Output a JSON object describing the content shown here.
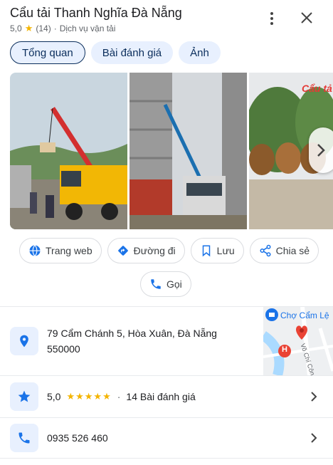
{
  "header": {
    "title": "Cẩu tải Thanh Nghĩa Đà Nẵng",
    "rating": "5,0",
    "review_count": "(14)",
    "category": "Dịch vụ vận tải"
  },
  "tabs": [
    {
      "label": "Tổng quan",
      "active": true
    },
    {
      "label": "Bài đánh giá",
      "active": false
    },
    {
      "label": "Ảnh",
      "active": false
    }
  ],
  "photos": {
    "overlay_text": "Cẩu tả"
  },
  "actions": [
    {
      "label": "Trang web",
      "icon": "globe-icon"
    },
    {
      "label": "Đường đi",
      "icon": "directions-icon"
    },
    {
      "label": "Lưu",
      "icon": "bookmark-icon"
    },
    {
      "label": "Chia sẻ",
      "icon": "share-icon"
    },
    {
      "label": "Gọi",
      "icon": "phone-icon"
    }
  ],
  "address": {
    "line1": "79 Cẩm Chánh 5, Hòa Xuân, Đà Nẵng",
    "line2": "550000"
  },
  "map": {
    "place_label": "Chợ Cẩm Lệ",
    "street_label": "Võ Chí Công",
    "hospital_marker": "H"
  },
  "rating_row": {
    "rating": "5,0",
    "stars": "★★★★★",
    "reviews": "14 Bài đánh giá"
  },
  "phone": {
    "number": "0935 526 460"
  },
  "colors": {
    "accent": "#1a73e8",
    "star": "#f4b400",
    "chip_bg": "#e8f0fe",
    "map_pin": "#ea4335"
  }
}
